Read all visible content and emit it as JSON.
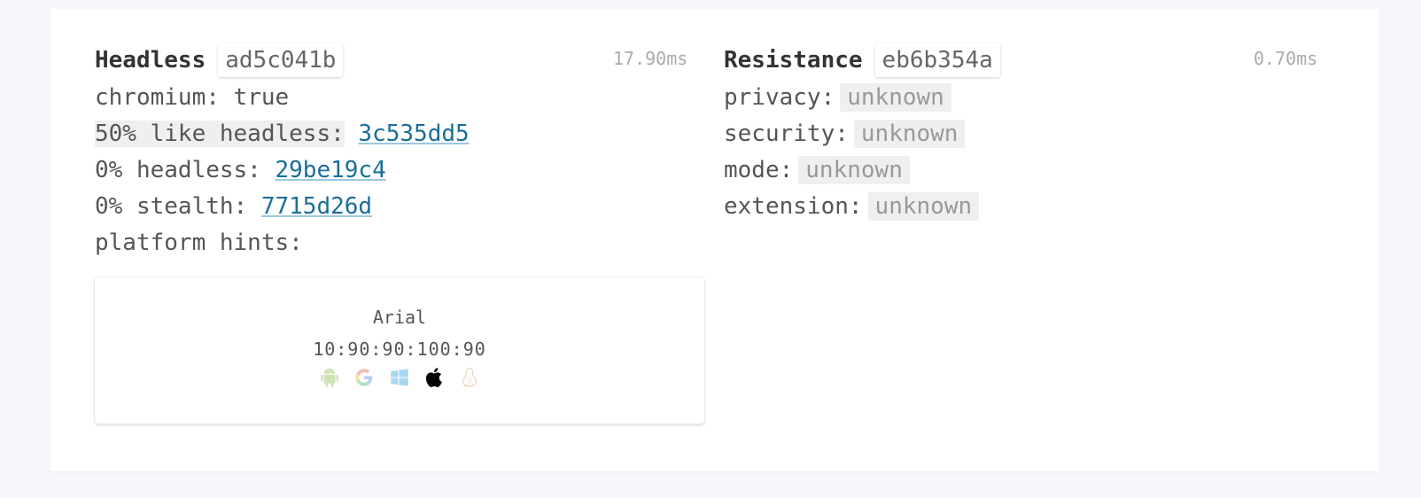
{
  "headless": {
    "title": "Headless",
    "hash": "ad5c041b",
    "time": "17.90ms",
    "chromium_label": "chromium:",
    "chromium_value": "true",
    "like_headless_label": "50% like headless:",
    "like_headless_hash": "3c535dd5",
    "headless_label": "0% headless:",
    "headless_hash": "29be19c4",
    "stealth_label": "0% stealth:",
    "stealth_hash": "7715d26d",
    "platform_hints_label": "platform hints:",
    "font_name": "Arial",
    "font_metrics": "10:90:90:100:90",
    "platform_icons": [
      "android-icon",
      "google-icon",
      "windows-icon",
      "apple-icon",
      "linux-icon"
    ],
    "active_platform": "apple-icon"
  },
  "resistance": {
    "title": "Resistance",
    "hash": "eb6b354a",
    "time": "0.70ms",
    "privacy_label": "privacy:",
    "privacy_value": "unknown",
    "security_label": "security:",
    "security_value": "unknown",
    "mode_label": "mode:",
    "mode_value": "unknown",
    "extension_label": "extension:",
    "extension_value": "unknown"
  },
  "colors": {
    "link": "#1a6e98",
    "chip_bg": "#efefef",
    "active_icon": "#000000"
  }
}
